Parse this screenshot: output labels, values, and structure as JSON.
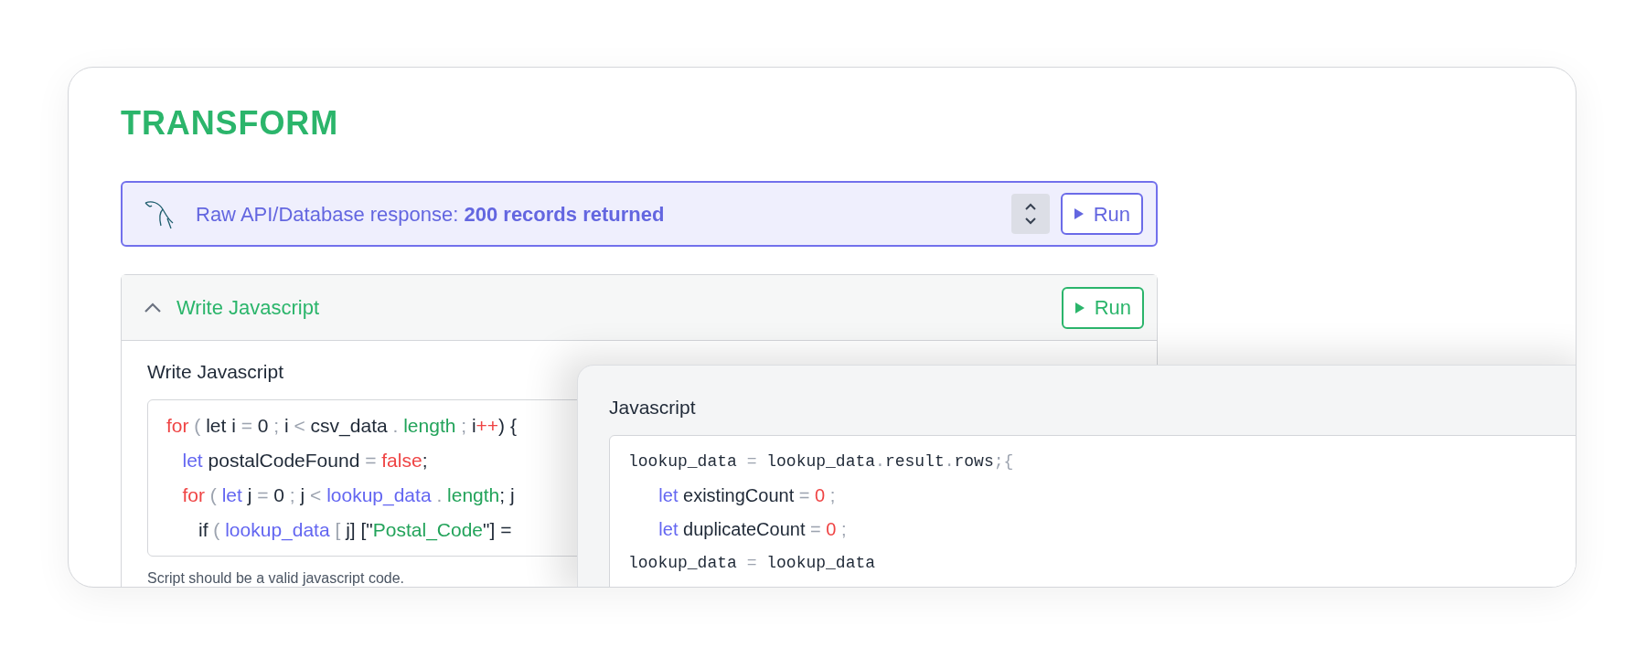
{
  "title": "TRANSFORM",
  "response_bar": {
    "text": "Raw API/Database response: **200 records returned**",
    "run_button": "Run"
  },
  "script_panel": {
    "expanded": true,
    "header": "Write Javascript",
    "run_button": "Run",
    "field_label": "Write Javascript",
    "helper_text": "Script should be a valid javascript code.",
    "code_lines": [
      [
        {
          "text": "for",
          "kind": "keyword"
        },
        {
          "text": " ( ",
          "kind": "punct"
        },
        {
          "text": "let i ",
          "kind": "plain"
        },
        {
          "text": "= ",
          "kind": "punct"
        },
        {
          "text": "0 ",
          "kind": "plain"
        },
        {
          "text": "; ",
          "kind": "punct"
        },
        {
          "text": "i ",
          "kind": "plain"
        },
        {
          "text": "< ",
          "kind": "punct"
        },
        {
          "text": "csv_data ",
          "kind": "plain"
        },
        {
          "text": ". ",
          "kind": "punct"
        },
        {
          "text": "length ",
          "kind": "property"
        },
        {
          "text": "; ",
          "kind": "punct"
        },
        {
          "text": "i",
          "kind": "plain"
        },
        {
          "text": "++",
          "kind": "keyword"
        },
        {
          "text": ") {",
          "kind": "plain"
        }
      ],
      [
        {
          "text": "   let",
          "kind": "declare"
        },
        {
          "text": " postalCodeFound ",
          "kind": "plain"
        },
        {
          "text": "= ",
          "kind": "punct"
        },
        {
          "text": "false",
          "kind": "keyword"
        },
        {
          "text": ";",
          "kind": "plain"
        }
      ],
      [
        {
          "text": "   for",
          "kind": "keyword"
        },
        {
          "text": " ( ",
          "kind": "punct"
        },
        {
          "text": "let",
          "kind": "declare"
        },
        {
          "text": " j ",
          "kind": "plain"
        },
        {
          "text": "= ",
          "kind": "punct"
        },
        {
          "text": "0 ",
          "kind": "plain"
        },
        {
          "text": "; ",
          "kind": "punct"
        },
        {
          "text": "j ",
          "kind": "plain"
        },
        {
          "text": "< ",
          "kind": "punct"
        },
        {
          "text": "lookup_data ",
          "kind": "declare"
        },
        {
          "text": ". ",
          "kind": "punct"
        },
        {
          "text": "length",
          "kind": "property"
        },
        {
          "text": "; j",
          "kind": "plain"
        }
      ],
      [
        {
          "text": "      if",
          "kind": "plain"
        },
        {
          "text": " ( ",
          "kind": "punct"
        },
        {
          "text": "lookup_data ",
          "kind": "declare"
        },
        {
          "text": "[ ",
          "kind": "punct"
        },
        {
          "text": "j] [\"",
          "kind": "plain"
        },
        {
          "text": "Postal_Code",
          "kind": "property"
        },
        {
          "text": "\"] =",
          "kind": "plain"
        }
      ]
    ]
  },
  "overlay_panel": {
    "label": "Javascript",
    "code_lines": [
      {
        "kind": "raw",
        "tokens": [
          {
            "text": "lookup_data ",
            "kind": "plain"
          },
          {
            "text": "= ",
            "kind": "punct"
          },
          {
            "text": "lookup_data",
            "kind": "plain"
          },
          {
            "text": ".",
            "kind": "punct"
          },
          {
            "text": "result",
            "kind": "plain"
          },
          {
            "text": ".",
            "kind": "punct"
          },
          {
            "text": "rows",
            "kind": "plain"
          },
          {
            "text": ";{",
            "kind": "punct"
          }
        ]
      },
      {
        "kind": "highlighted",
        "tokens": [
          {
            "text": "      let",
            "kind": "declare"
          },
          {
            "text": " existingCount ",
            "kind": "plain"
          },
          {
            "text": "= ",
            "kind": "punct"
          },
          {
            "text": "0",
            "kind": "keyword"
          },
          {
            "text": " ;",
            "kind": "punct"
          }
        ]
      },
      {
        "kind": "highlighted",
        "tokens": [
          {
            "text": "      let",
            "kind": "declare"
          },
          {
            "text": " duplicateCount ",
            "kind": "plain"
          },
          {
            "text": "= ",
            "kind": "punct"
          },
          {
            "text": "0",
            "kind": "keyword"
          },
          {
            "text": " ;",
            "kind": "punct"
          }
        ]
      },
      {
        "kind": "raw",
        "tokens": [
          {
            "text": "lookup_data ",
            "kind": "plain"
          },
          {
            "text": "= ",
            "kind": "punct"
          },
          {
            "text": "lookup_data",
            "kind": "plain"
          }
        ]
      }
    ]
  }
}
